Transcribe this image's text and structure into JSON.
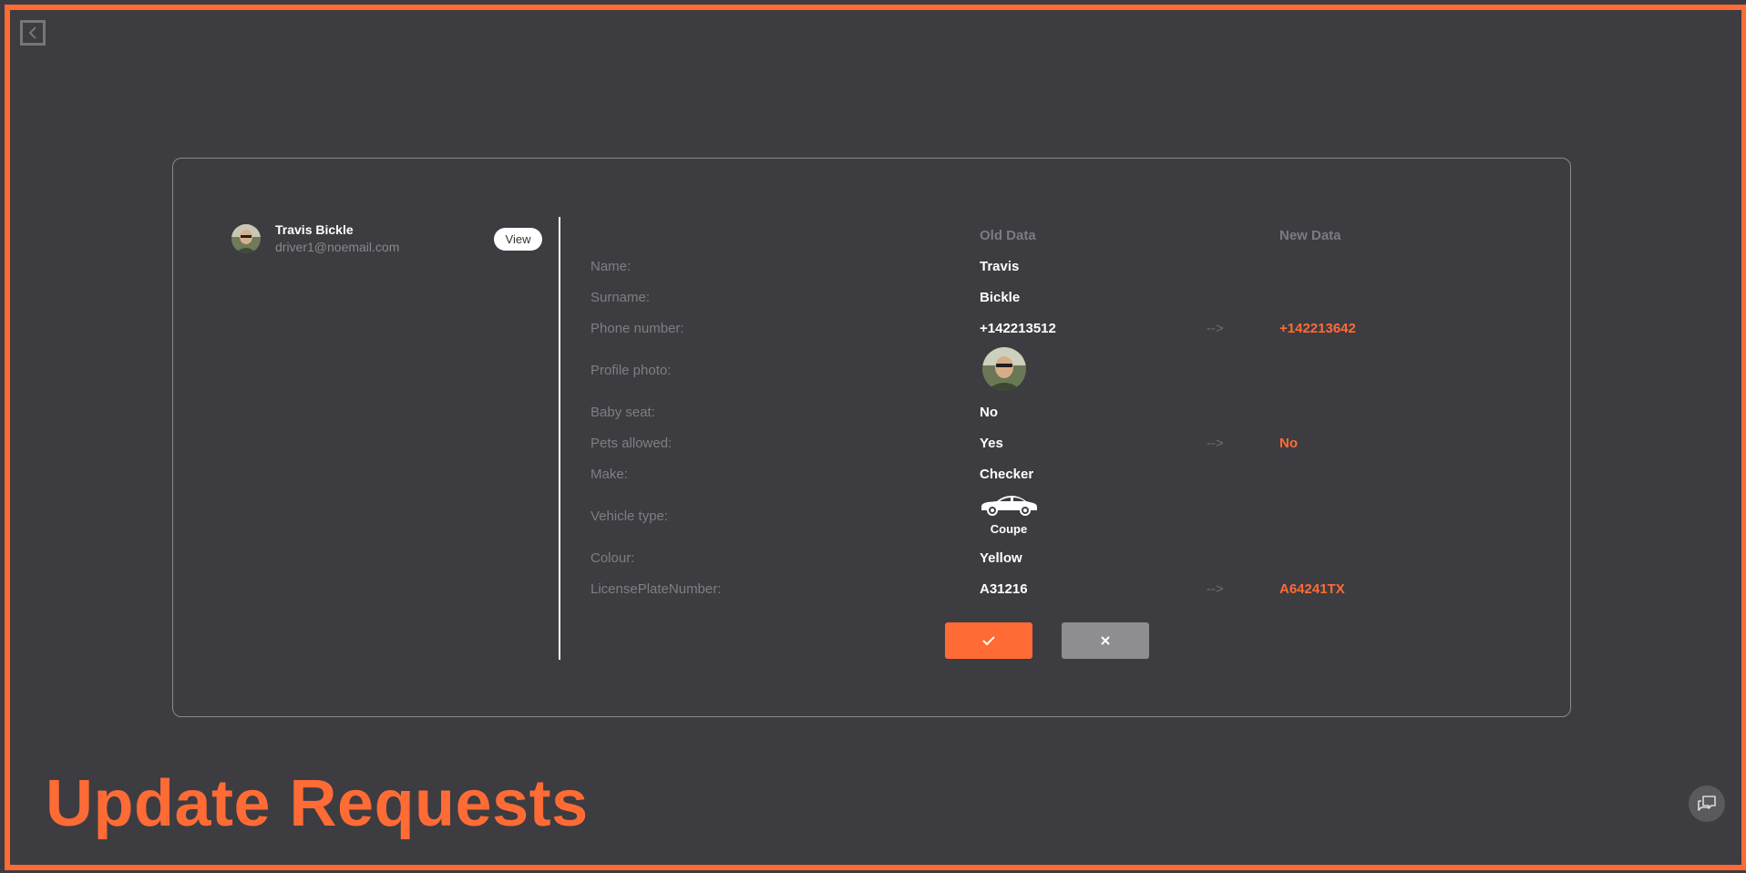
{
  "colors": {
    "accent": "#ff6b35",
    "background": "#3d3c41",
    "reject": "#8e8d92"
  },
  "icons": {
    "back": "chevron-left-icon",
    "accept": "check-icon",
    "reject": "close-icon",
    "chat": "chat-icon",
    "vehicle": "car-icon"
  },
  "driver": {
    "name": "Travis Bickle",
    "email": "driver1@noemail.com",
    "view_label": "View"
  },
  "columns": {
    "old": "Old Data",
    "new": "New Data"
  },
  "arrow": "-->",
  "rows": [
    {
      "label": "Name:",
      "old": "Travis"
    },
    {
      "label": "Surname:",
      "old": "Bickle"
    },
    {
      "label": "Phone number:",
      "old": "+142213512",
      "new": "+142213642"
    },
    {
      "label": "Profile photo:"
    },
    {
      "label": "Baby seat:",
      "old": "No"
    },
    {
      "label": "Pets allowed:",
      "old": "Yes",
      "new": "No"
    },
    {
      "label": "Make:",
      "old": "Checker"
    },
    {
      "label": "Vehicle type:",
      "old": "Coupe"
    },
    {
      "label": "Colour:",
      "old": "Yellow"
    },
    {
      "label": "LicensePlateNumber:",
      "old": "A31216",
      "new": "A64241TX"
    }
  ],
  "page_title": "Update Requests"
}
